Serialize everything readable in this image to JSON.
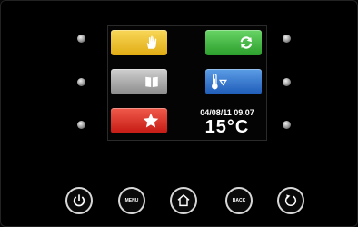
{
  "screen": {
    "date_time": "04/08/11 09.07",
    "temperature": "15°C"
  },
  "tiles": [
    {
      "name": "hand-icon",
      "color": "#e1ac14"
    },
    {
      "name": "refresh-icon",
      "color": "#2c9f2c"
    },
    {
      "name": "book-icon",
      "color": "#8c8c8c"
    },
    {
      "name": "thermometer-icon",
      "color": "#1e5cb8"
    },
    {
      "name": "star-icon",
      "color": "#c51a14"
    }
  ],
  "buttons": {
    "menu_label": "MENU",
    "back_label": "BACK",
    "icons": [
      "power-icon",
      "home-icon",
      "refresh-icon"
    ]
  }
}
